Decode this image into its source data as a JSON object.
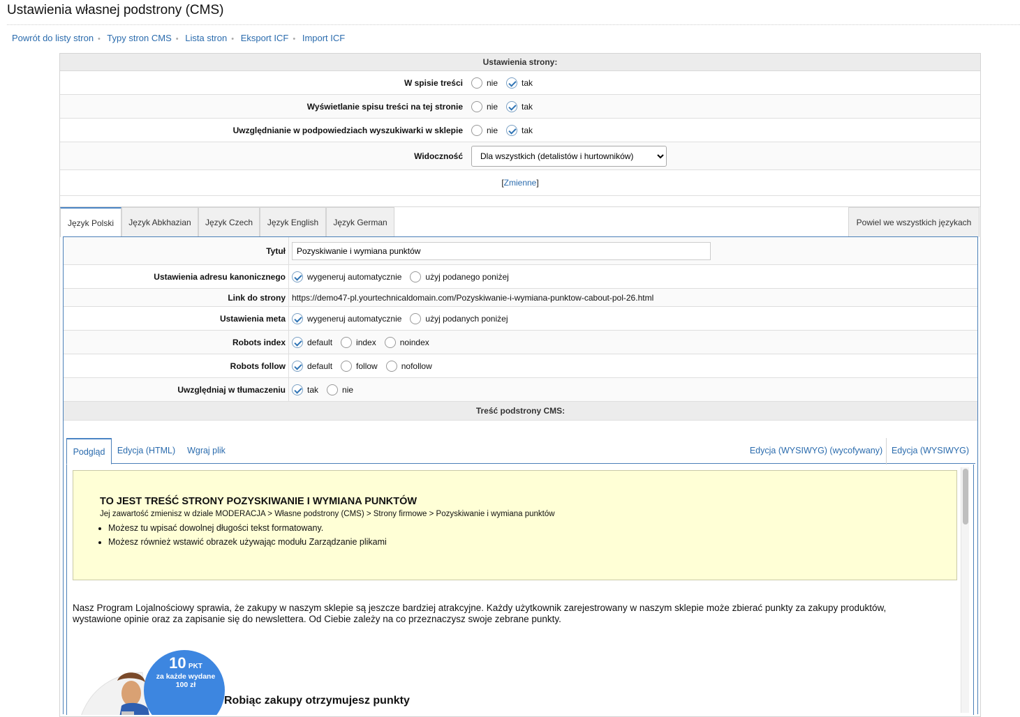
{
  "page": {
    "title": "Ustawienia własnej podstrony (CMS)"
  },
  "nav": [
    {
      "label": "Powrót do listy stron"
    },
    {
      "label": "Typy stron CMS"
    },
    {
      "label": "Lista stron"
    },
    {
      "label": "Eksport ICF"
    },
    {
      "label": "Import ICF"
    }
  ],
  "settings": {
    "header": "Ustawienia strony:",
    "toc": {
      "label": "W spisie treści",
      "no": "nie",
      "yes": "tak",
      "selected": "tak"
    },
    "toc_display": {
      "label": "Wyświetlanie spisu treści na tej stronie",
      "no": "nie",
      "yes": "tak",
      "selected": "tak"
    },
    "search_hints": {
      "label": "Uwzględnianie w podpowiedziach wyszukiwarki w sklepie",
      "no": "nie",
      "yes": "tak",
      "selected": "tak"
    },
    "visibility": {
      "label": "Widoczność",
      "value": "Dla wszystkich (detalistów i hurtowników)"
    },
    "variables": {
      "open": "[",
      "link": "Zmienne",
      "close": "]"
    }
  },
  "lang_tabs": [
    "Język Polski",
    "Język Abkhazian",
    "Język Czech",
    "Język English",
    "Język German"
  ],
  "lang_tab_active": "Język Polski",
  "repeat_all": "Powiel we wszystkich językach",
  "lang": {
    "title": {
      "label": "Tytuł",
      "value": "Pozyskiwanie i wymiana punktów"
    },
    "canonical": {
      "label": "Ustawienia adresu kanonicznego",
      "opt1": "wygeneruj automatycznie",
      "opt2": "użyj podanego poniżej"
    },
    "link": {
      "label": "Link do strony",
      "value": "https://demo47-pl.yourtechnicaldomain.com/Pozyskiwanie-i-wymiana-punktow-cabout-pol-26.html"
    },
    "meta": {
      "label": "Ustawienia meta",
      "opt1": "wygeneruj automatycznie",
      "opt2": "użyj podanych poniżej"
    },
    "robots_index": {
      "label": "Robots index",
      "opt1": "default",
      "opt2": "index",
      "opt3": "noindex"
    },
    "robots_follow": {
      "label": "Robots follow",
      "opt1": "default",
      "opt2": "follow",
      "opt3": "nofollow"
    },
    "translate": {
      "label": "Uwzględniaj w tłumaczeniu",
      "opt1": "tak",
      "opt2": "nie"
    },
    "content_header": "Treść podstrony CMS:"
  },
  "content_tabs": {
    "preview": "Podgląd",
    "html": "Edycja (HTML)",
    "upload": "Wgraj plik",
    "wysiwyg_old": "Edycja (WYSIWYG) (wycofywany)",
    "wysiwyg": "Edycja (WYSIWYG)"
  },
  "preview": {
    "notice_title": "TO JEST TREŚĆ STRONY POZYSKIWANIE I WYMIANA PUNKTÓW",
    "notice_sub": "Jej zawartość zmienisz w dziale MODERACJA > Własne podstrony (CMS) > Strony firmowe > Pozyskiwanie i wymiana punktów",
    "bullets": [
      "Możesz tu wpisać dowolnej długości tekst formatowany.",
      "Możesz również wstawić obrazek używając modułu Zarządzanie plikami"
    ],
    "intro": "Nasz Program Lojalnościowy sprawia, że zakupy w naszym sklepie są jeszcze bardziej atrakcyjne. Każdy użytkownik zarejestrowany w naszym sklepie może zbierać punkty za zakupy produktów, wystawione opinie oraz za zapisanie się do newslettera. Od Ciebie zależy na co przeznaczysz swoje zebrane punkty.",
    "badge_num": "10",
    "badge_unit": "PKT",
    "badge_line1": "za każde wydane",
    "badge_line2": "100 zł",
    "promo_heading": "Robiąc zakupy otrzymujesz punkty"
  }
}
